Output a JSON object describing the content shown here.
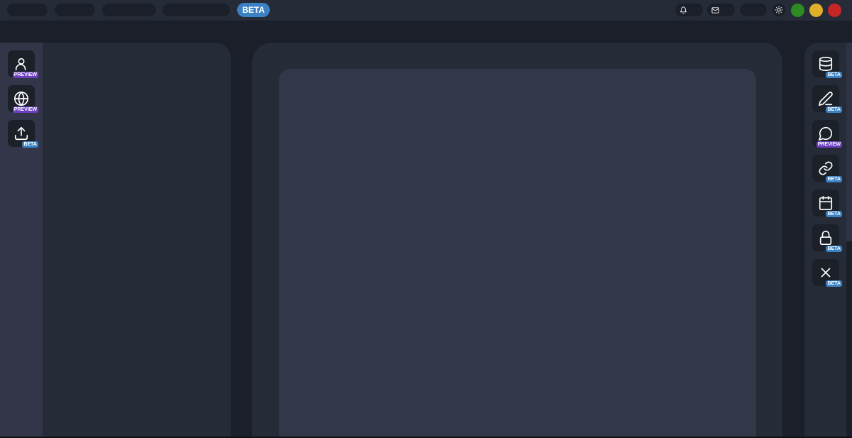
{
  "topbar": {
    "beta_label": "BETA",
    "window_controls": {
      "green": "#2e8b22",
      "yellow": "#e0b02a",
      "red": "#c72626"
    }
  },
  "left_tools": [
    {
      "icon": "user-icon",
      "badge": "PREVIEW",
      "badge_type": "preview"
    },
    {
      "icon": "globe-icon",
      "badge": "PREVIEW",
      "badge_type": "preview"
    },
    {
      "icon": "upload-icon",
      "badge": "BETA",
      "badge_type": "beta"
    }
  ],
  "right_tools": [
    {
      "icon": "database-icon",
      "badge": "BETA",
      "badge_type": "beta"
    },
    {
      "icon": "pen-icon",
      "badge": "BETA",
      "badge_type": "beta"
    },
    {
      "icon": "chat-icon",
      "badge": "PREVIEW",
      "badge_type": "preview"
    },
    {
      "icon": "link-icon",
      "badge": "BETA",
      "badge_type": "beta"
    },
    {
      "icon": "calendar-icon",
      "badge": "BETA",
      "badge_type": "beta"
    },
    {
      "icon": "lock-icon",
      "badge": "BETA",
      "badge_type": "beta"
    },
    {
      "icon": "close-icon",
      "badge": "BETA",
      "badge_type": "beta"
    }
  ],
  "colors": {
    "accent_beta": "#3b82c4",
    "accent_preview": "#6b3fc0",
    "background": "#1b1f29",
    "panel": "#262b38"
  }
}
